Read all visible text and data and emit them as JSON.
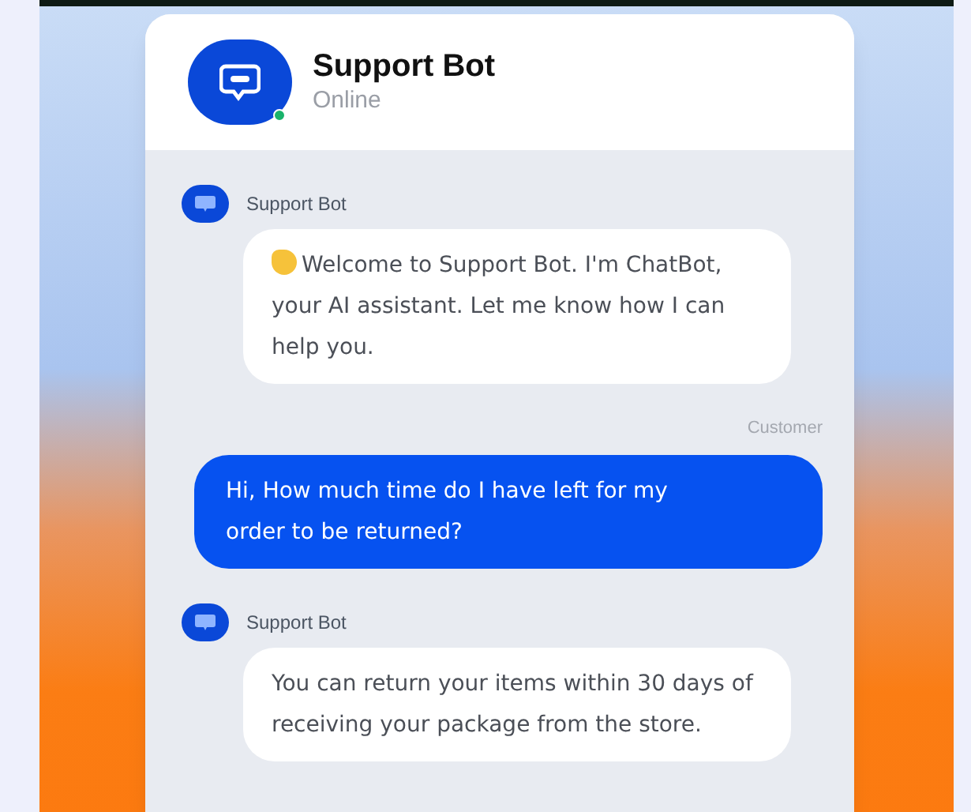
{
  "header": {
    "title": "Support Bot",
    "status": "Online",
    "online": true
  },
  "messages": [
    {
      "kind": "bot",
      "sender": "Support Bot",
      "wave": true,
      "text": "Welcome to Support Bot. I'm ChatBot, your AI assistant. Let me know how I can help you."
    },
    {
      "kind": "customer",
      "sender": "Customer",
      "text": "Hi, How much time do I have left for my order to be returned?"
    },
    {
      "kind": "bot",
      "sender": "Support Bot",
      "wave": false,
      "text": "You can return your items within 30 days of receiving your package from the store."
    }
  ]
}
